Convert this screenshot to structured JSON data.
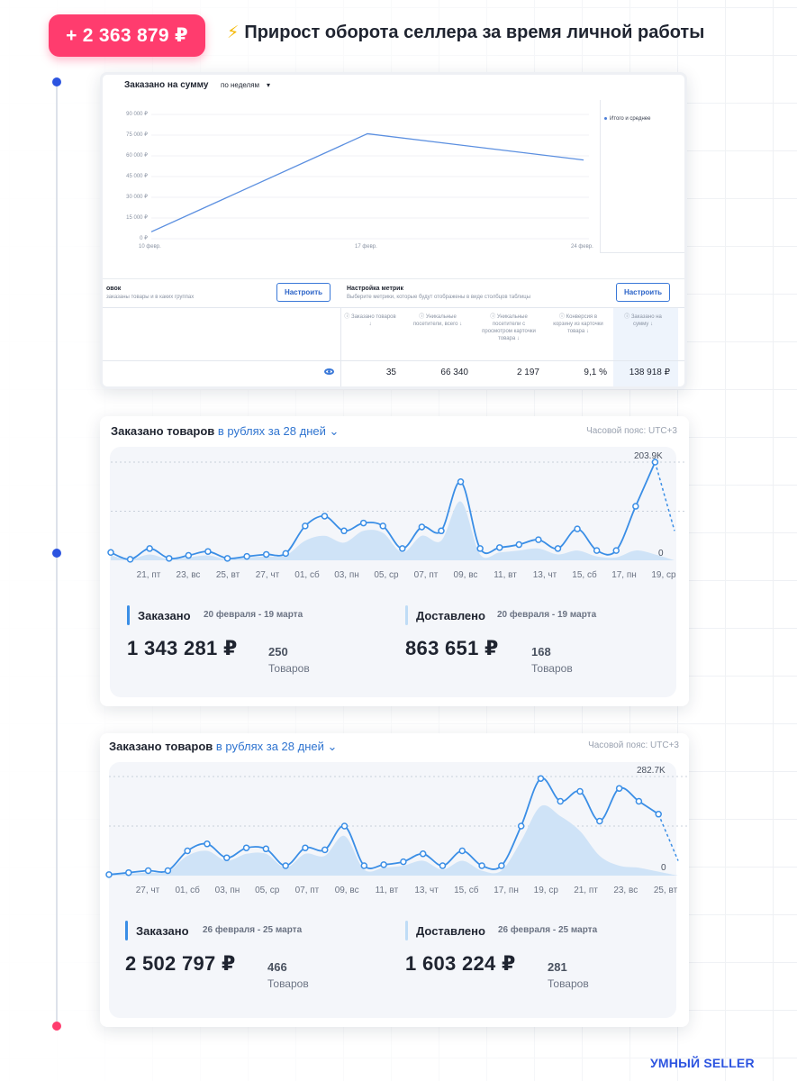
{
  "header": {
    "amount": "+ 2 363 879 ₽",
    "title": "Прирост оборота селлера за время личной работы"
  },
  "card1": {
    "title": "Заказано на сумму",
    "period_select": "по неделям",
    "y_ticks": [
      "90 000 ₽",
      "75 000 ₽",
      "60 000 ₽",
      "45 000 ₽",
      "30 000 ₽",
      "15 000 ₽",
      "0 ₽"
    ],
    "x_ticks": [
      "10 февр.",
      "17 февр.",
      "24 февр."
    ],
    "legend": "Итого и среднее",
    "group_label": "овок",
    "group_sub": "заказаны товары и в каких группах",
    "group_button": "Настроить",
    "metrics_label": "Настройка метрик",
    "metrics_sub": "Выберите метрики, которые будут отображены в виде столбцов таблицы",
    "metrics_button": "Настроить",
    "columns": [
      "Заказано товаров",
      "Уникальные посетители, всего",
      "Уникальные посетители с просмотром карточки товара",
      "Конверсия в корзину из карточки товара",
      "Заказано на сумму"
    ],
    "values": [
      "35",
      "66 340",
      "2 197",
      "9,1 %",
      "138 918 ₽"
    ]
  },
  "card2": {
    "head": "Заказано товаров",
    "head_blue": "в рублях за 28 дней",
    "timezone": "Часовой пояс: UTC+3",
    "peak": "203.9K",
    "zero": "0",
    "x_labels": [
      "21, пт",
      "23, вс",
      "25, вт",
      "27, чт",
      "01, сб",
      "03, пн",
      "05, ср",
      "07, пт",
      "09, вс",
      "11, вт",
      "13, чт",
      "15, сб",
      "17, пн",
      "19, ср"
    ],
    "ordered": {
      "label": "Заказано",
      "dates": "20 февраля - 19 марта",
      "amount": "1 343 281 ₽",
      "count": "250",
      "unit": "Товаров"
    },
    "delivered": {
      "label": "Доставлено",
      "dates": "20 февраля - 19 марта",
      "amount": "863 651 ₽",
      "count": "168",
      "unit": "Товаров"
    }
  },
  "card3": {
    "head": "Заказано товаров",
    "head_blue": "в рублях за 28 дней",
    "timezone": "Часовой пояс: UTC+3",
    "peak": "282.7K",
    "zero": "0",
    "x_labels": [
      "27, чт",
      "01, сб",
      "03, пн",
      "05, ср",
      "07, пт",
      "09, вс",
      "11, вт",
      "13, чт",
      "15, сб",
      "17, пн",
      "19, ср",
      "21, пт",
      "23, вс",
      "25, вт"
    ],
    "ordered": {
      "label": "Заказано",
      "dates": "26 февраля - 25 марта",
      "amount": "2 502 797 ₽",
      "count": "466",
      "unit": "Товаров"
    },
    "delivered": {
      "label": "Доставлено",
      "dates": "26 февраля - 25 марта",
      "amount": "1 603 224 ₽",
      "count": "281",
      "unit": "Товаров"
    }
  },
  "brand": "УМНЫЙ SELLER",
  "chart_data": [
    {
      "type": "line",
      "title": "Заказано на сумму",
      "x": [
        "10 февр.",
        "17 февр.",
        "24 февр."
      ],
      "values": [
        5000,
        76000,
        57000
      ],
      "ylim": [
        0,
        90000
      ]
    },
    {
      "type": "area",
      "title": "Заказано товаров",
      "series": [
        {
          "name": "Заказано",
          "values": [
            8,
            1,
            12,
            2,
            5,
            9,
            2,
            4,
            6,
            7,
            35,
            45,
            30,
            38,
            35,
            12,
            34,
            30,
            80,
            12,
            13,
            16,
            21,
            12,
            32,
            10,
            10,
            55,
            100,
            30
          ]
        },
        {
          "name": "Доставлено",
          "values": [
            5,
            1,
            6,
            1,
            3,
            5,
            1,
            3,
            4,
            5,
            20,
            25,
            18,
            30,
            28,
            8,
            25,
            20,
            60,
            6,
            8,
            10,
            12,
            6,
            10,
            4,
            3,
            10,
            6,
            0
          ]
        }
      ]
    },
    {
      "type": "area",
      "title": "Заказано товаров",
      "series": [
        {
          "name": "Заказано",
          "values": [
            1,
            3,
            5,
            5,
            25,
            32,
            18,
            28,
            27,
            10,
            28,
            26,
            50,
            10,
            11,
            14,
            22,
            10,
            25,
            10,
            10,
            50,
            98,
            75,
            85,
            55,
            88,
            75,
            62,
            15
          ]
        },
        {
          "name": "Доставлено",
          "values": [
            1,
            2,
            3,
            4,
            20,
            25,
            15,
            22,
            22,
            8,
            22,
            20,
            40,
            6,
            8,
            10,
            15,
            6,
            15,
            5,
            5,
            35,
            70,
            60,
            45,
            20,
            10,
            8,
            4,
            0
          ]
        }
      ]
    }
  ]
}
